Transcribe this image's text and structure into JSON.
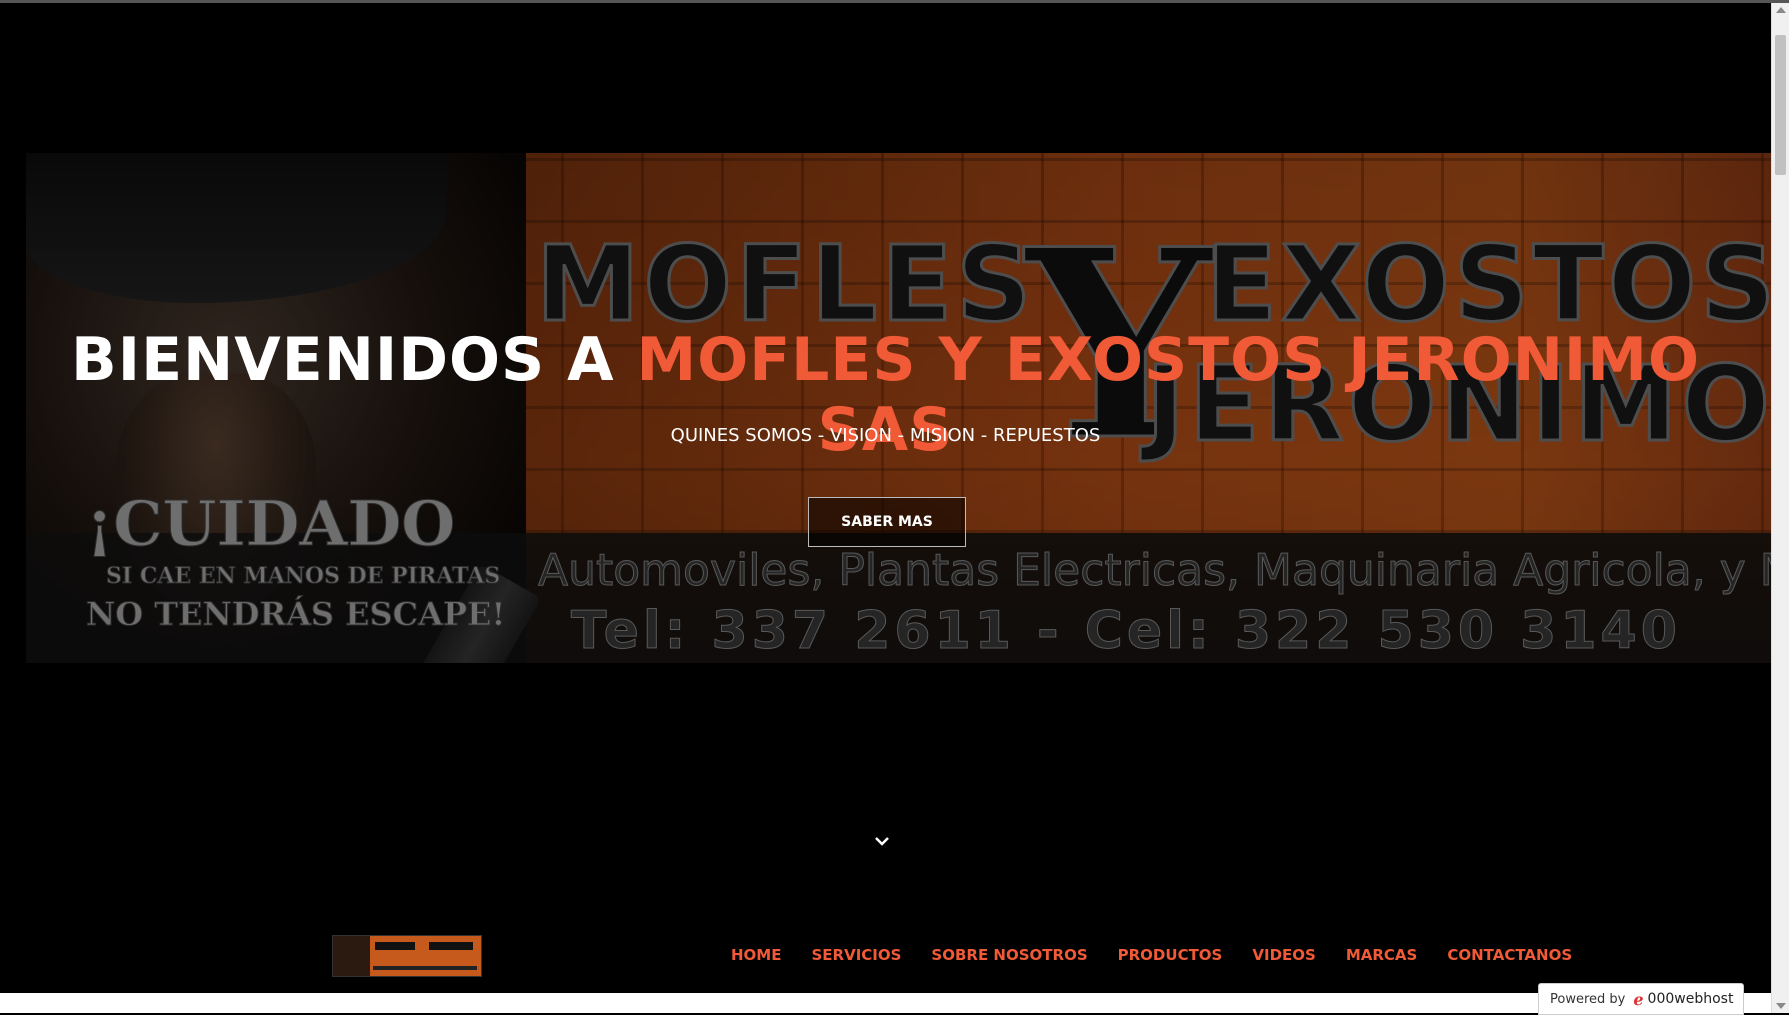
{
  "hero": {
    "title_prefix": "BIENVENIDOS A ",
    "title_accent": "MOFLES Y EXOSTOS JERONIMO SAS",
    "subtitle": "QUINES SOMOS - VISION - MISION - REPUESTOS",
    "cta_label": "SABER MAS"
  },
  "banner": {
    "logo_word_1": "MOFLES",
    "logo_word_2": "EXOSTOS",
    "logo_word_3": "JERONIMO",
    "logo_y": "Y",
    "strip_line_1": "Automoviles, Plantas Electricas, Maquinaria Agricola, y Motores Estacionarios.",
    "strip_line_2": "Tel: 337 2611 - Cel: 322 530 3140",
    "warning_1": "¡CUIDADO",
    "warning_2": "SI CAE EN MANOS DE PIRATAS",
    "warning_3": "NO TENDRÁS ESCAPE!"
  },
  "nav": {
    "items": [
      {
        "label": "HOME"
      },
      {
        "label": "SERVICIOS"
      },
      {
        "label": "SOBRE NOSOTROS"
      },
      {
        "label": "PRODUCTOS"
      },
      {
        "label": "VIDEOS"
      },
      {
        "label": "MARCAS"
      },
      {
        "label": "CONTACTANOS"
      }
    ]
  },
  "footer_badge": {
    "label": "Powered by",
    "brand": "000webhost"
  },
  "colors": {
    "accent": "#f05a36",
    "background": "#000000"
  }
}
